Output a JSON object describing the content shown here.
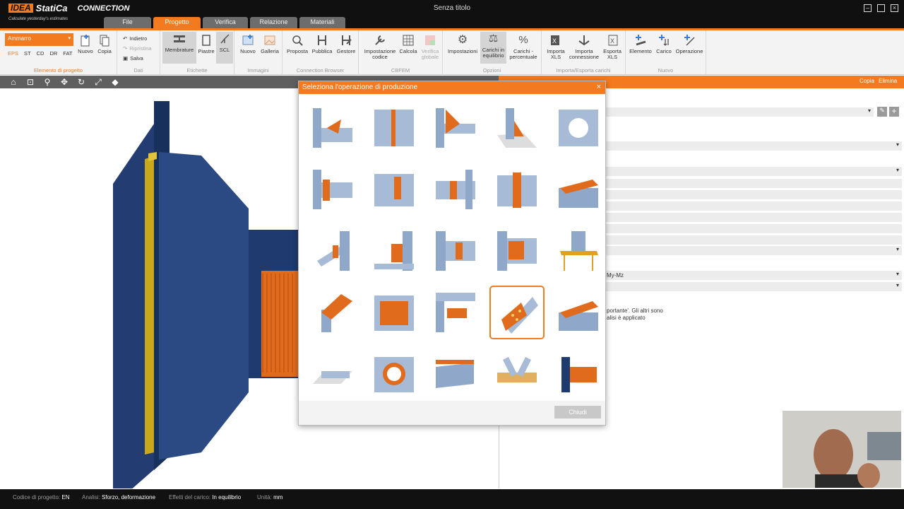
{
  "app": {
    "logo_idea": "IDEA",
    "logo_statica": "StatiCa",
    "product": "CONNECTION",
    "tagline": "Calculate yesterday's estimates",
    "window_title": "Senza titolo"
  },
  "tabs": [
    {
      "label": "File"
    },
    {
      "label": "Progetto"
    },
    {
      "label": "Verifica"
    },
    {
      "label": "Relazione"
    },
    {
      "label": "Materiali"
    }
  ],
  "ribbon": {
    "project_dropdown": "Ammarro",
    "codes": [
      "EPS",
      "ST",
      "CD",
      "DR",
      "FAT"
    ],
    "new_label": "Nuovo",
    "copy_label": "Copia",
    "group_project": "Elemento di progetto",
    "undo": "Indietro",
    "redo": "Ripristina",
    "save": "Salva",
    "group_data": "Dati",
    "members": "Membrature",
    "plates": "Piastre",
    "scl": "SCL",
    "group_labels": "Etichette",
    "img_new": "Nuovo",
    "gallery": "Galleria",
    "group_images": "Immagini",
    "propose": "Proposta",
    "publish": "Pubblica",
    "manager": "Gestore",
    "group_browser": "Connection Browser",
    "code_setup": "Impostazione codice",
    "calculate": "Calcola",
    "global_check": "Verifica globale",
    "group_cbfem": "CBFEM",
    "settings": "Impostazioni",
    "loads_eq": "Carichi in equilibrio",
    "loads_pct": "Carichi - percentuale",
    "group_options": "Opzioni",
    "import_xls": "Importa XLS",
    "import_conn": "Importa connessione",
    "export_xls": "Esporta XLS",
    "group_io": "Importa/Esporta carichi",
    "new_member": "Elemento",
    "new_load": "Carico",
    "new_operation": "Operazione",
    "group_new": "Nuovo"
  },
  "right_panel": {
    "copy": "Copia",
    "delete": "Elimina",
    "load_label": "My-Mz",
    "note_line1": "portante'. Gli altri sono",
    "note_line2": "alisi è applicato"
  },
  "dialog": {
    "title": "Seleziona l'operazione di produzione",
    "close_button": "Chiudi",
    "selected_index": 18
  },
  "status": {
    "code_label": "Codice di progetto:",
    "code_value": "EN",
    "analysis_label": "Analisi:",
    "analysis_value": "Sforzo, deformazione",
    "effects_label": "Effetti del carico:",
    "effects_value": "In equilibrio",
    "units_label": "Unità:",
    "units_value": "mm"
  },
  "colors": {
    "accent": "#f47a20",
    "steel": "#8fa7c9",
    "member_dark": "#1f3a6e",
    "plate": "#e06b1c"
  }
}
